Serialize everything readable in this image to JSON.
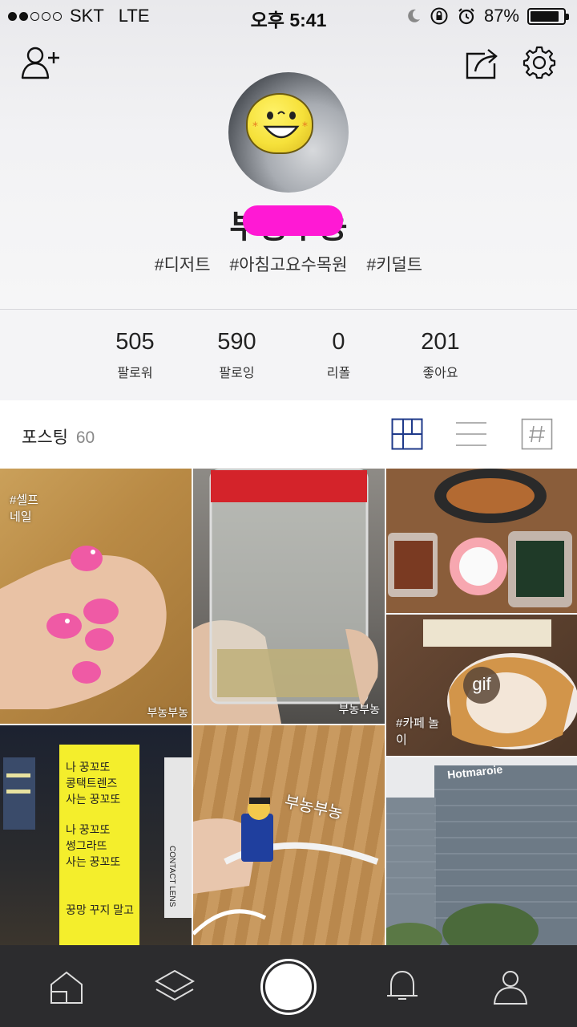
{
  "status_bar": {
    "carrier": "SKT",
    "network": "LTE",
    "time": "오후 5:41",
    "battery_percent": "87%",
    "battery_level": 0.87,
    "signal_bars_on": 2,
    "signal_bars_total": 5
  },
  "header": {
    "add_friend_icon": "person-plus-icon",
    "share_icon": "share-icon",
    "settings_icon": "gear-icon"
  },
  "profile": {
    "username": "부농부농",
    "tags": [
      "#디저트",
      "#아침고요수목원",
      "#키덜트"
    ]
  },
  "stats": [
    {
      "value": "505",
      "label": "팔로워"
    },
    {
      "value": "590",
      "label": "팔로잉"
    },
    {
      "value": "0",
      "label": "리폴"
    },
    {
      "value": "201",
      "label": "좋아요"
    }
  ],
  "posting": {
    "label": "포스팅",
    "count": "60",
    "view_icons": [
      "grid-view-icon",
      "list-view-icon",
      "hashtag-view-icon"
    ]
  },
  "grid": {
    "tiles": [
      {
        "watermark": "부농부농",
        "sticker": "#셀프 네일"
      },
      {
        "watermark": "부농부농"
      },
      {},
      {
        "badge": "gif",
        "sticker": "#카페 놀이"
      },
      {
        "poster_lines": [
          "나 꿍꼬또",
          "콩택트렌즈",
          "사는 꿍꼬또",
          "",
          "나 꿍꼬또",
          "썽그라뜨",
          "사는 꿍꼬또",
          "",
          "",
          "꿍망 꾸지 말고"
        ],
        "side_sign": "CONTACT LENS"
      },
      {
        "watermark": "부농부농"
      },
      {
        "building_sign": "Hotmaroie"
      }
    ]
  },
  "bottom_nav": {
    "items": [
      "home-icon",
      "layers-icon",
      "camera-button",
      "bell-icon",
      "profile-icon"
    ]
  },
  "colors": {
    "accent": "#1f3a8a",
    "censor": "#ff19d4",
    "nav_bg": "#2c2c2e"
  }
}
